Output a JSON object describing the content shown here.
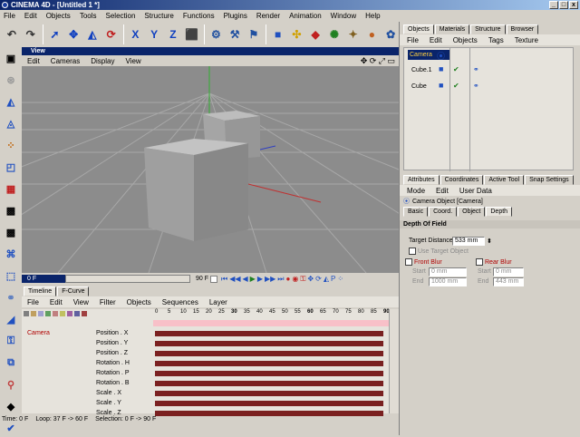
{
  "window": {
    "title": "CINEMA 4D - [Untitled 1 *]",
    "minimize": "_",
    "maximize": "□",
    "close": "x"
  },
  "menu": [
    "File",
    "Edit",
    "Objects",
    "Tools",
    "Selection",
    "Structure",
    "Functions",
    "Plugins",
    "Render",
    "Animation",
    "Window",
    "Help"
  ],
  "view": {
    "title": "View",
    "menu": [
      "Edit",
      "Cameras",
      "Display",
      "View"
    ],
    "frame_start": "0 F",
    "frame_end": "90 F",
    "current_frame": "0"
  },
  "objects": {
    "tabs": [
      "Objects",
      "Materials",
      "Structure",
      "Browser"
    ],
    "menu": [
      "File",
      "Edit",
      "Objects",
      "Tags",
      "Texture"
    ],
    "items": [
      "Camera",
      "Cube.1",
      "Cube"
    ]
  },
  "attributes": {
    "tabs": [
      "Attributes",
      "Coordinates",
      "Active Tool",
      "Snap Settings"
    ],
    "menu": [
      "Mode",
      "Edit",
      "User Data"
    ],
    "object_label": "Camera Object [Camera]",
    "subtabs": [
      "Basic",
      "Coord.",
      "Object",
      "Depth"
    ],
    "section": "Depth Of Field",
    "target_distance_label": "Target Distance",
    "target_distance_value": "533 mm",
    "use_target_label": "Use Target Object",
    "front_blur_label": "Front Blur",
    "rear_blur_label": "Rear Blur",
    "start_label": "Start",
    "end_label": "End",
    "front_start": "0 mm",
    "front_end": "1000 mm",
    "rear_start": "0 mm",
    "rear_end": "443 mm"
  },
  "timeline": {
    "tabs": [
      "Timeline",
      "F-Curve"
    ],
    "menu": [
      "File",
      "Edit",
      "View",
      "Filter",
      "Objects",
      "Sequences",
      "Layer"
    ],
    "ruler": [
      "0",
      "5",
      "10",
      "15",
      "20",
      "25",
      "30",
      "35",
      "40",
      "45",
      "50",
      "55",
      "60",
      "65",
      "70",
      "75",
      "80",
      "85",
      "90"
    ],
    "object": "Camera",
    "tracks": [
      "Position . X",
      "Position . Y",
      "Position . Z",
      "Rotation . H",
      "Rotation . P",
      "Rotation . B",
      "Scale . X",
      "Scale . Y",
      "Scale . Z"
    ]
  },
  "status": {
    "time": "Time: 0 F",
    "loop": "Loop: 37 F -> 60 F",
    "selection": "Selection: 0 F -> 90 F"
  }
}
